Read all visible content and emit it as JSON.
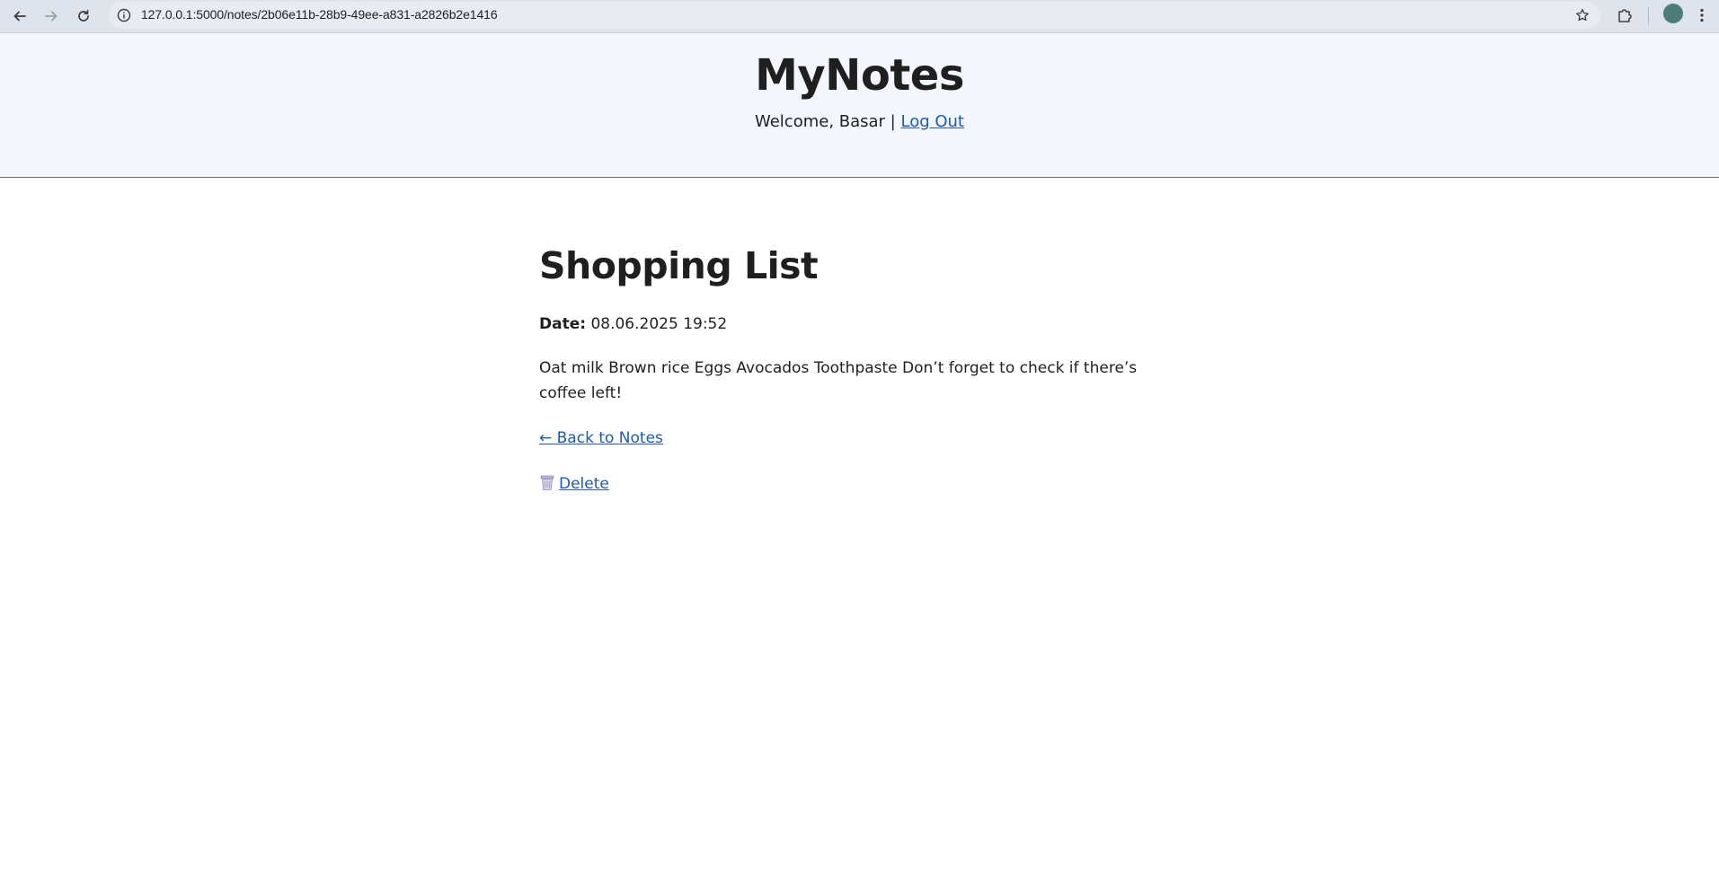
{
  "browser": {
    "url": "127.0.0.1:5000/notes/2b06e11b-28b9-49ee-a831-a2826b2e1416",
    "profile_color": "#4d7d7a"
  },
  "header": {
    "title": "MyNotes",
    "welcome_text": "Welcome, Basar |",
    "logout_label": "Log Out"
  },
  "note": {
    "title": "Shopping List",
    "date_label": "Date:",
    "date_value": "08.06.2025 19:52",
    "body": "Oat milk Brown rice Eggs Avocados Toothpaste Don’t forget to check if there’s coffee left!",
    "back_label": "← Back to Notes",
    "delete_label": "Delete"
  },
  "colors": {
    "link": "#1f5aa6",
    "header_bg": "#f3f6fd",
    "text": "#1f1f1f"
  }
}
